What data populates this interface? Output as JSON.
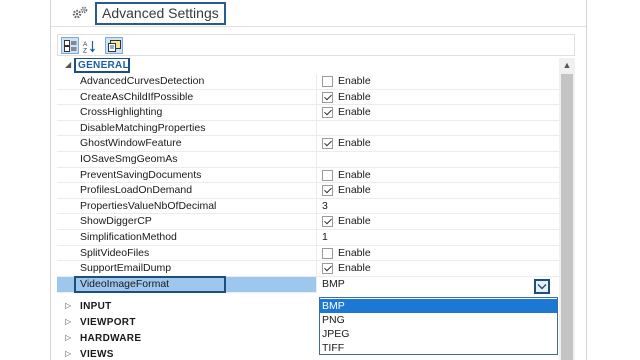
{
  "window": {
    "title": "Advanced Settings",
    "icon": "gears-icon"
  },
  "toolbar": {
    "buttons": [
      {
        "name": "categorized-view-button",
        "icon": "categorized-icon",
        "active": true
      },
      {
        "name": "alphabetical-sort-button",
        "icon": "sort-az-icon",
        "active": false
      },
      {
        "name": "property-pages-button",
        "icon": "property-pages-icon",
        "active": true
      }
    ]
  },
  "grid": {
    "categories": {
      "general": "GENERAL",
      "input": "INPUT",
      "viewport": "VIEWPORT",
      "hardware": "HARDWARE",
      "views": "VIEWS"
    },
    "properties": [
      {
        "name": "AdvancedCurvesDetection",
        "type": "checkbox",
        "checked": false,
        "label": "Enable"
      },
      {
        "name": "CreateAsChildIfPossible",
        "type": "checkbox",
        "checked": true,
        "label": "Enable"
      },
      {
        "name": "CrossHighlighting",
        "type": "checkbox",
        "checked": true,
        "label": "Enable"
      },
      {
        "name": "DisableMatchingProperties",
        "type": "empty",
        "label": ""
      },
      {
        "name": "GhostWindowFeature",
        "type": "checkbox",
        "checked": true,
        "label": "Enable"
      },
      {
        "name": "IOSaveSmgGeomAs",
        "type": "empty",
        "label": ""
      },
      {
        "name": "PreventSavingDocuments",
        "type": "checkbox",
        "checked": false,
        "label": "Enable"
      },
      {
        "name": "ProfilesLoadOnDemand",
        "type": "checkbox",
        "checked": true,
        "label": "Enable"
      },
      {
        "name": "PropertiesValueNbOfDecimal",
        "type": "text",
        "label": "3"
      },
      {
        "name": "ShowDiggerCP",
        "type": "checkbox",
        "checked": true,
        "label": "Enable"
      },
      {
        "name": "SimplificationMethod",
        "type": "text",
        "label": "1"
      },
      {
        "name": "SplitVideoFiles",
        "type": "checkbox",
        "checked": false,
        "label": "Enable"
      },
      {
        "name": "SupportEmailDump",
        "type": "checkbox",
        "checked": true,
        "label": "Enable"
      }
    ],
    "selected": {
      "name": "VideoImageFormat",
      "value": "BMP"
    },
    "dropdown_options": [
      "BMP",
      "PNG",
      "JPEG",
      "TIFF"
    ],
    "dropdown_selected_index": 0
  },
  "colors": {
    "highlight": "#9ec7ee",
    "selection": "#1b78d4",
    "accent_box": "#1e4f7c"
  }
}
